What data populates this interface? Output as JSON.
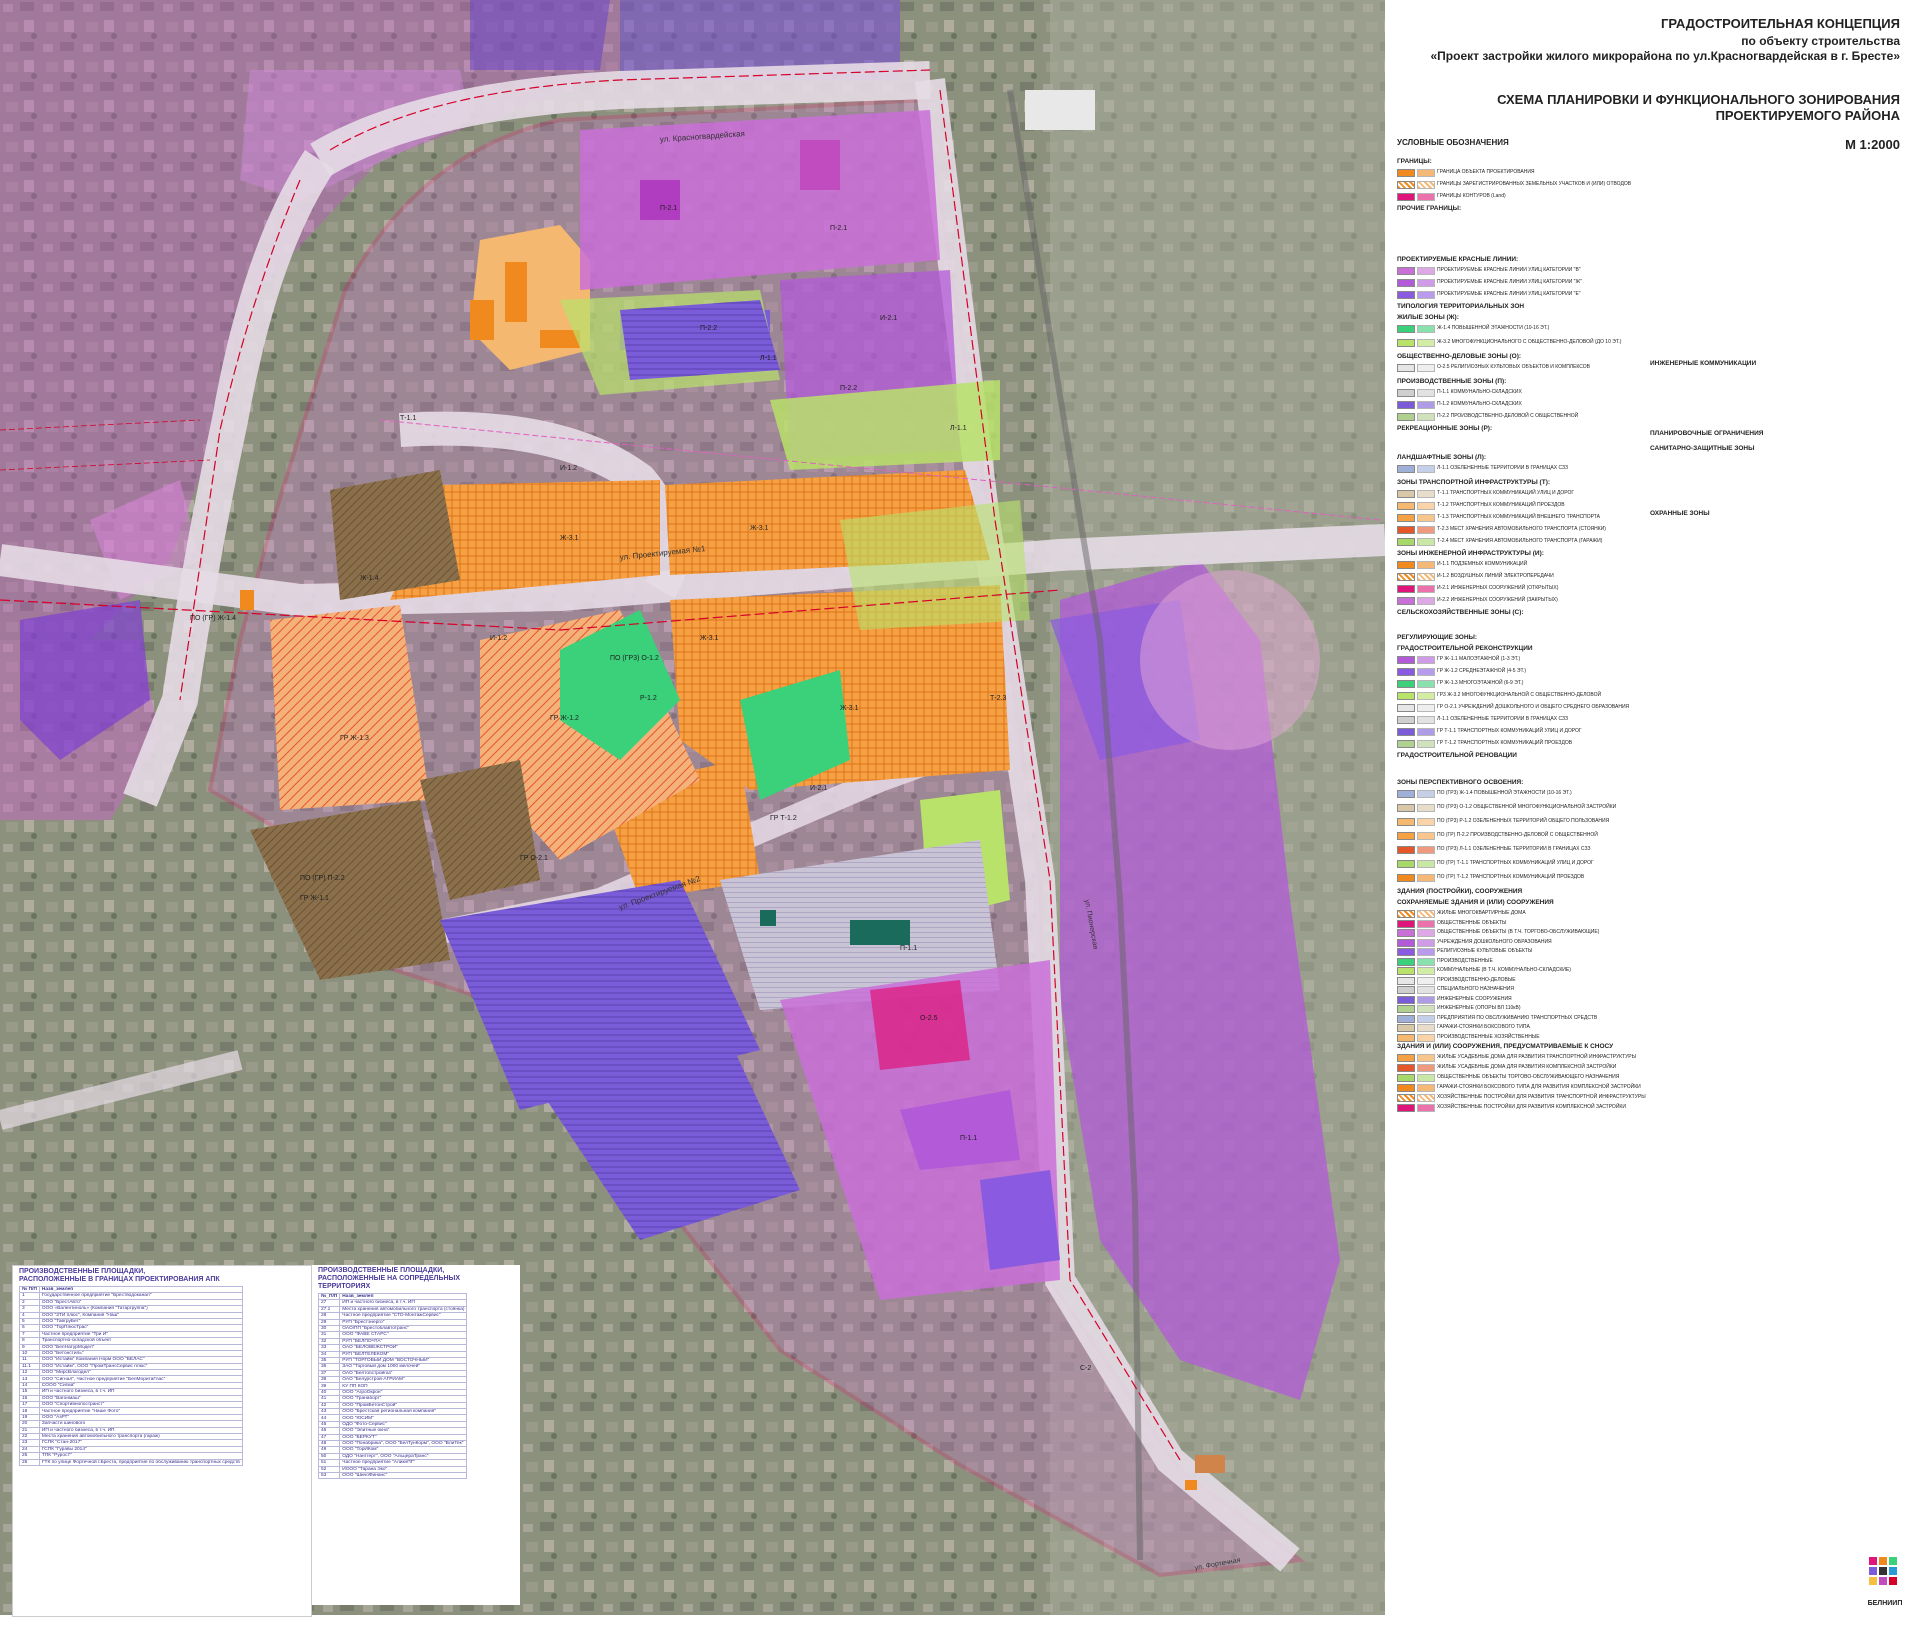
{
  "header": {
    "title_main": "ГРАДОСТРОИТЕЛЬНАЯ КОНЦЕПЦИЯ",
    "title_sub": "по объекту строительства",
    "title_project": "«Проект застройки жилого микрорайона по ул.Красногвардейская в г. Бресте»",
    "scheme_line1": "СХЕМА ПЛАНИРОВКИ И ФУНКЦИОНАЛЬНОГО ЗОНИРОВАНИЯ",
    "scheme_line2": "ПРОЕКТИРУЕМОГО РАЙОНА",
    "scale": "М 1:2000"
  },
  "legend": {
    "heading": "УСЛОВНЫЕ ОБОЗНАЧЕНИЯ",
    "borders": "ГРАНИЦЫ:",
    "borders_items": [
      "ГРАНИЦА ОБЪЕКТА ПРОЕКТИРОВАНИЯ",
      "ГРАНИЦЫ ЗАРЕГИСТРИРОВАННЫХ ЗЕМЕЛЬНЫХ УЧАСТКОВ И (ИЛИ) ОТВОДОВ",
      "ГРАНИЦЫ КОНТУРОВ (Land)"
    ],
    "other_borders": "ПРОЧИЕ ГРАНИЦЫ:",
    "red_lines": "ПРОЕКТИРУЕМЫЕ КРАСНЫЕ ЛИНИИ:",
    "red_items": [
      "ПРОЕКТИРУЕМЫЕ КРАСНЫЕ ЛИНИИ УЛИЦ КАТЕГОРИИ \"В\"",
      "ПРОЕКТИРУЕМЫЕ КРАСНЫЕ ЛИНИИ УЛИЦ КАТЕГОРИИ \"Ж\"",
      "ПРОЕКТИРУЕМЫЕ КРАСНЫЕ ЛИНИИ УЛИЦ КАТЕГОРИИ \"Е\""
    ],
    "engineering": "ИНЖЕНЕРНЫЕ КОММУНИКАЦИИ",
    "typology": "ТИПОЛОГИЯ ТЕРРИТОРИАЛЬНЫХ ЗОН",
    "residential": "ЖИЛЫЕ ЗОНЫ (Ж):",
    "res_items": [
      "Ж-1.4 ПОВЫШЕННОЙ ЭТАЖНОСТИ (10-16 ЭТ.)",
      "Ж-3.2 МНОГОФУНКЦИОНАЛЬНОГО С ОБЩЕСТВЕННО-ДЕЛОВОЙ (ДО 10 ЭТ.)"
    ],
    "public": "ОБЩЕСТВЕННО-ДЕЛОВЫЕ ЗОНЫ (О):",
    "public_items": [
      "О-2.5 РЕЛИГИОЗНЫХ КУЛЬТОВЫХ ОБЪЕКТОВ И КОМПЛЕКСОВ"
    ],
    "production": "ПРОИЗВОДСТВЕННЫЕ ЗОНЫ (П):",
    "prod_items": [
      "П-1.1 КОММУНАЛЬНО-СКЛАДСКИХ",
      "П-1.2 КОММУНАЛЬНО-СКЛАДСКИХ",
      "П-2.2 ПРОИЗВОДСТВЕННО-ДЕЛОВОЙ С ОБЩЕСТВЕННОЙ"
    ],
    "recreation": "РЕКРЕАЦИОННЫЕ ЗОНЫ (Р):",
    "landscape": "ЛАНДШАФТНЫЕ ЗОНЫ (Л):",
    "land_items": [
      "Л-1.1 ОЗЕЛЕНЕННЫЕ ТЕРРИТОРИИ В ГРАНИЦАХ СЗЗ"
    ],
    "transport": "ЗОНЫ ТРАНСПОРТНОЙ ИНФРАСТРУКТУРЫ (Т):",
    "trans_items": [
      "Т-1.1 ТРАНСПОРТНЫХ КОММУНИКАЦИЙ УЛИЦ И ДОРОГ",
      "Т-1.2 ТРАНСПОРТНЫХ КОММУНИКАЦИЙ ПРОЕЗДОВ",
      "Т-1.3 ТРАНСПОРТНЫХ КОММУНИКАЦИЙ ВНЕШНЕГО ТРАНСПОРТА",
      "Т-2.3 МЕСТ ХРАНЕНИЯ АВТОМОБИЛЬНОГО ТРАНСПОРТА (СТОЯНКИ)",
      "Т-2.4 МЕСТ ХРАНЕНИЯ АВТОМОБИЛЬНОГО ТРАНСПОРТА (ГАРАЖИ)"
    ],
    "engineering_zones": "ЗОНЫ ИНЖЕНЕРНОЙ ИНФРАСТРУКТУРЫ (И):",
    "eng_items": [
      "И-1.1 ПОДЗЕМНЫХ КОММУНИКАЦИЙ",
      "И-1.2 ВОЗДУШНЫХ ЛИНИЙ ЭЛЕКТРОПЕРЕДАЧИ",
      "И-2.1 ИНЖЕНЕРНЫХ СООРУЖЕНИЙ (ОТКРЫТЫХ)",
      "И-2.2 ИНЖЕНЕРНЫХ СООРУЖЕНИЙ (ЗАКРЫТЫХ)"
    ],
    "agri": "СЕЛЬСКОХОЗЯЙСТВЕННЫЕ ЗОНЫ (С):",
    "regulating": "РЕГУЛИРУЮЩИЕ ЗОНЫ:",
    "reconstruction": "ГРАДОСТРОИТЕЛЬНОЙ РЕКОНСТРУКЦИИ",
    "recon_items": [
      "ГР Ж-1.1 МАЛОЭТАЖНОЙ (1-3 ЭТ.)",
      "ГР Ж-1.2 СРЕДНЕЭТАЖНОЙ (4-5 ЭТ.)",
      "ГР Ж-1.3 МНОГОЭТАЖНОЙ (6-9 ЭТ.)",
      "ГР3 Ж-3.2 МНОГОФУНКЦИОНАЛЬНОЙ С ОБЩЕСТВЕННО-ДЕЛОВОЙ",
      "ГР О-2.1 УЧРЕЖДЕНИЙ ДОШКОЛЬНОГО И ОБЩЕГО СРЕДНЕГО ОБРАЗОВАНИЯ",
      "Л-1.1 ОЗЕЛЕНЕННЫЕ ТЕРРИТОРИИ В ГРАНИЦАХ СЗЗ",
      "ГР Т-1.1 ТРАНСПОРТНЫХ КОММУНИКАЦИЙ УЛИЦ И ДОРОГ",
      "ГР Т-1.2 ТРАНСПОРТНЫХ КОММУНИКАЦИЙ ПРОЕЗДОВ"
    ],
    "renovation": "ГРАДОСТРОИТЕЛЬНОЙ РЕНОВАЦИИ",
    "perspective": "ЗОНЫ ПЕРСПЕКТИВНОГО ОСВОЕНИЯ:",
    "persp_items": [
      "ПО (ГР3) Ж-1.4 ПОВЫШЕННОЙ ЭТАЖНОСТИ (10-16 ЭТ.)",
      "ПО (ГР3) О-1.2 ОБЩЕСТВЕННОЙ МНОГОФУНКЦИОНАЛЬНОЙ ЗАСТРОЙКИ",
      "ПО (ГР3) Р-1.2 ОЗЕЛЕНЕННЫХ ТЕРРИТОРИЙ ОБЩЕГО ПОЛЬЗОВАНИЯ",
      "ПО (ГР) П-2.2 ПРОИЗВОДСТВЕННО-ДЕЛОВОЙ С ОБЩЕСТВЕННОЙ",
      "ПО (ГР3) Л-1.1 ОЗЕЛЕНЕННЫЕ ТЕРРИТОРИИ В ГРАНИЦАХ СЗЗ",
      "ПО (ГР) Т-1.1 ТРАНСПОРТНЫХ КОММУНИКАЦИЙ УЛИЦ И ДОРОГ",
      "ПО (ГР) Т-1.2 ТРАНСПОРТНЫХ КОММУНИКАЦИЙ ПРОЕЗДОВ"
    ],
    "buildings": "ЗДАНИЯ (ПОСТРОЙКИ), СООРУЖЕНИЯ",
    "preserved": "СОХРАНЯЕМЫЕ ЗДАНИЯ И (ИЛИ) СООРУЖЕНИЯ",
    "bld_items": [
      "ЖИЛЫЕ МНОГОКВАРТИРНЫЕ ДОМА",
      "ОБЩЕСТВЕННЫЕ ОБЪЕКТЫ",
      "ОБЩЕСТВЕННЫЕ ОБЪЕКТЫ (В Т.Ч. ТОРГОВО-ОБСЛУЖИВАЮЩИЕ)",
      "УЧРЕЖДЕНИЯ ДОШКОЛЬНОГО ОБРАЗОВАНИЯ",
      "РЕЛИГИОЗНЫЕ КУЛЬТОВЫЕ ОБЪЕКТЫ",
      "ПРОИЗВОДСТВЕННЫЕ",
      "КОММУНАЛЬНЫЕ (В Т.Ч. КОММУНАЛЬНО-СКЛАДСКИЕ)",
      "ПРОИЗВОДСТВЕННО-ДЕЛОВЫЕ",
      "СПЕЦИАЛЬНОГО НАЗНАЧЕНИЯ",
      "ИНЖЕНЕРНЫЕ СООРУЖЕНИЯ",
      "ИНЖЕНЕРНЫЕ (ОПОРЫ ВЛ 110кВ)",
      "ПРЕДПРИЯТИЯ ПО ОБСЛУЖИВАНИЮ ТРАНСПОРТНЫХ СРЕДСТВ",
      "ГАРАЖИ-СТОЯНКИ БОКСОВОГО ТИПА",
      "ПРОИЗВОДСТВЕННЫЕ ХОЗЯЙСТВЕННЫЕ"
    ],
    "demolition": "ЗДАНИЯ И (ИЛИ) СООРУЖЕНИЯ, ПРЕДУСМАТРИВАЕМЫЕ К СНОСУ",
    "demo_items": [
      "ЖИЛЫЕ УСАДЕБНЫЕ ДОМА ДЛЯ РАЗВИТИЯ ТРАНСПОРТНОЙ ИНФРАСТРУКТУРЫ",
      "ЖИЛЫЕ УСАДЕБНЫЕ ДОМА ДЛЯ РАЗВИТИЯ КОМПЛЕКСНОЙ ЗАСТРОЙКИ",
      "ОБЩЕСТВЕННЫЕ ОБЪЕКТЫ ТОРГОВО-ОБСЛУЖИВАЮЩЕГО НАЗНАЧЕНИЯ",
      "ГАРАЖИ-СТОЯНКИ БОКСОВОГО ТИПА ДЛЯ РАЗВИТИЯ КОМПЛЕКСНОЙ ЗАСТРОЙКИ",
      "ХОЗЯЙСТВЕННЫЕ ПОСТРОЙКИ ДЛЯ РАЗВИТИЯ ТРАНСПОРТНОЙ ИНФРАСТРУКТУРЫ",
      "ХОЗЯЙСТВЕННЫЕ ПОСТРОЙКИ ДЛЯ РАЗВИТИЯ КОМПЛЕКСНОЙ ЗАСТРОЙКИ"
    ],
    "constraints": "ПЛАНИРОВОЧНЫЕ ОГРАНИЧЕНИЯ",
    "sanitary": "САНИТАРНО-ЗАЩИТНЫЕ ЗОНЫ",
    "protection": "ОХРАННЫЕ ЗОНЫ",
    "logo_text": "БЕЛНИИП"
  },
  "table_left": {
    "title1": "ПРОИЗВОДСТВЕННЫЕ ПЛОЩАДКИ,",
    "title2": "РАСПОЛОЖЕННЫЕ В ГРАНИЦАХ ПРОЕКТИРОВАНИЯ АПК",
    "header": [
      "№ П/П",
      "Назв_землеп"
    ],
    "rows": [
      [
        "1",
        "Государственное предприятие \"Брестводоканал\""
      ],
      [
        "2",
        "ООО \"БрестАвто\""
      ],
      [
        "3",
        "ООО «Валентиноль» (Компания \"Татаргруппа\")"
      ],
      [
        "4",
        "ООО \"ЗТИ плюс\", Компания \"Наш\""
      ],
      [
        "5",
        "ООО \"ТавгруБет\""
      ],
      [
        "6",
        "ООО \"ТорПлюсТрас\""
      ],
      [
        "7",
        "Частное предприятие \"Три И\""
      ],
      [
        "8",
        "Транспортно-складской объект"
      ],
      [
        "9",
        "ООО \"БелНатурМодел\""
      ],
      [
        "10",
        "ООО \"Бетонстиль\""
      ],
      [
        "11",
        "ООО \"Истайм\" Компания Норм ООО \"БЕЛАС\""
      ],
      [
        "11.1",
        "ООО \"Истайм\", ООО \"ПромТрансСервис плюс\""
      ],
      [
        "12",
        "ООО \"МирсВлагодел\""
      ],
      [
        "13",
        "ООО \"Сигнал\", Частное предприятие \"БелМоритаГлас\""
      ],
      [
        "14",
        "СООО \"Сигма\""
      ],
      [
        "15",
        "ИП и частного бизнеса, в т.ч. ИП"
      ],
      [
        "16",
        "ООО \"Вагонмаш\""
      ],
      [
        "17",
        "ООО \"Спортивнопостранст\""
      ],
      [
        "18",
        "Частное предприятие \"Наше Фото\""
      ],
      [
        "19",
        "ООО \"АзРТ\""
      ],
      [
        "20",
        "Запчасти шинового"
      ],
      [
        "21",
        "ИП и частного бизнеса, в т.ч. ИП"
      ],
      [
        "22",
        "Места хранения автомобильного транспорта (гараж)"
      ],
      [
        "23",
        "ГСПК \"Стан-2017\""
      ],
      [
        "24",
        "ГСПК \"Гуравы 2014\""
      ],
      [
        "25",
        "ТПК \"Рурос7\""
      ],
      [
        "26",
        "ГТК по улице Фортечной г.Бреста, предприятие по обслуживанию транспортных средств"
      ]
    ]
  },
  "table_right": {
    "title1": "ПРОИЗВОДСТВЕННЫЕ ПЛОЩАДКИ,",
    "title2": "РАСПОЛОЖЕННЫЕ НА СОПРЕДЕЛЬНЫХ ТЕРРИТОРИЯХ",
    "header": [
      "№_П/П",
      "Назв_землеп"
    ],
    "rows": [
      [
        "27",
        "ИП и частного бизнеса, в т.ч. ИП"
      ],
      [
        "27.1",
        "Места хранения автомобильного транспорта (стоянка)"
      ],
      [
        "28",
        "Частное предприятие \"СТО-МонтажСервис\""
      ],
      [
        "29",
        "РУП \"Брестэнерго\""
      ],
      [
        "30",
        "ОАО/ПП \"Брестоблавтотранс\""
      ],
      [
        "31",
        "ООО \"ФАВЕ СТАРС\""
      ],
      [
        "32",
        "РУП \"БЕЛПОЧТА\""
      ],
      [
        "33",
        "ОАО \"БЕЛОВЕЖСТРОЙ\""
      ],
      [
        "34",
        "РУП \"БЕЛТЕЛЕКОМ\""
      ],
      [
        "35",
        "РУП \"ТОРГОВЫЙ ДОМ \"ВОСТОЧНЫЙ\""
      ],
      [
        "36",
        "ЗАО \"Торговый дом 1000 мелочей\""
      ],
      [
        "37",
        "ОАО \"Белтопстройгаз\""
      ],
      [
        "38",
        "ОАО \"Белурстрой-АГРИАМ\""
      ],
      [
        "39",
        "КУ ПП КОП"
      ],
      [
        "40",
        "ООО \"АгроОкрон\""
      ],
      [
        "41",
        "ООО \"Гранаборт\""
      ],
      [
        "42",
        "ООО \"ПромБетонСтрой\""
      ],
      [
        "43",
        "ООО \"Брестская региональная компания\""
      ],
      [
        "44",
        "ООО \"ЮСИМ\""
      ],
      [
        "45",
        "ОДО \"Фото-Сервис\""
      ],
      [
        "46",
        "ООО \"Элитные окна\""
      ],
      [
        "47",
        "ООО \"БЕРКУТ\""
      ],
      [
        "48",
        "ООО \"Понабрика\", ООО \"БелТунКорм\", ООО \"ВлиТек\""
      ],
      [
        "49",
        "ООО \"ТорИКом\""
      ],
      [
        "50",
        "ОДО \"Нантгерт\", ООО \"АльцераТранс\""
      ],
      [
        "51",
        "Частное предприятие \"АликнПГ\""
      ],
      [
        "52",
        "ИООО \"Тарана Эко\""
      ],
      [
        "53",
        "ООО \"ШиноФинанс\""
      ]
    ]
  },
  "map": {
    "street_krasnogvardeyskaya": "ул. Красногвардейская",
    "street_proektiruemaya1": "ул. Проектируемая №1",
    "street_proektiruemaya2": "ул. Проектируемая №2",
    "street_fortechnaya": "ул. Фортечная",
    "street_pionerskaya": "ул. Пионерская",
    "zone_labels": [
      "Ж-3.1",
      "Ж-3.1",
      "Ж-3.1",
      "Ж-3.1",
      "Ж-1.4",
      "ГР Ж-1.3",
      "ГР Ж-1.2",
      "ГР Ж-1.1",
      "ГР О-2.1",
      "П-2.1",
      "П-2.1",
      "П-2.2",
      "П-2.2",
      "П-1.1",
      "П-1.1",
      "И-2.1",
      "И-2.1",
      "И-1.2",
      "И-1.2",
      "Л-1.1",
      "Л-1.1",
      "Р-1.2",
      "Т-1.1",
      "Т-2.3",
      "О-2.5",
      "ПО (ГР) Ж-1.4",
      "ПО (ГР3) О-1.2",
      "ПО (ГР) П-2.2",
      "ГР Т-1.2",
      "С-2"
    ],
    "colors": {
      "residential": "#f39a2c",
      "production": "#c96fd8",
      "commercial": "#9b5fe0",
      "green": "#b8e26a",
      "road": "#e6dbe6",
      "boundary": "#e0157a",
      "red_line": "#d6002a",
      "aerial": "#8a8f7c"
    }
  }
}
